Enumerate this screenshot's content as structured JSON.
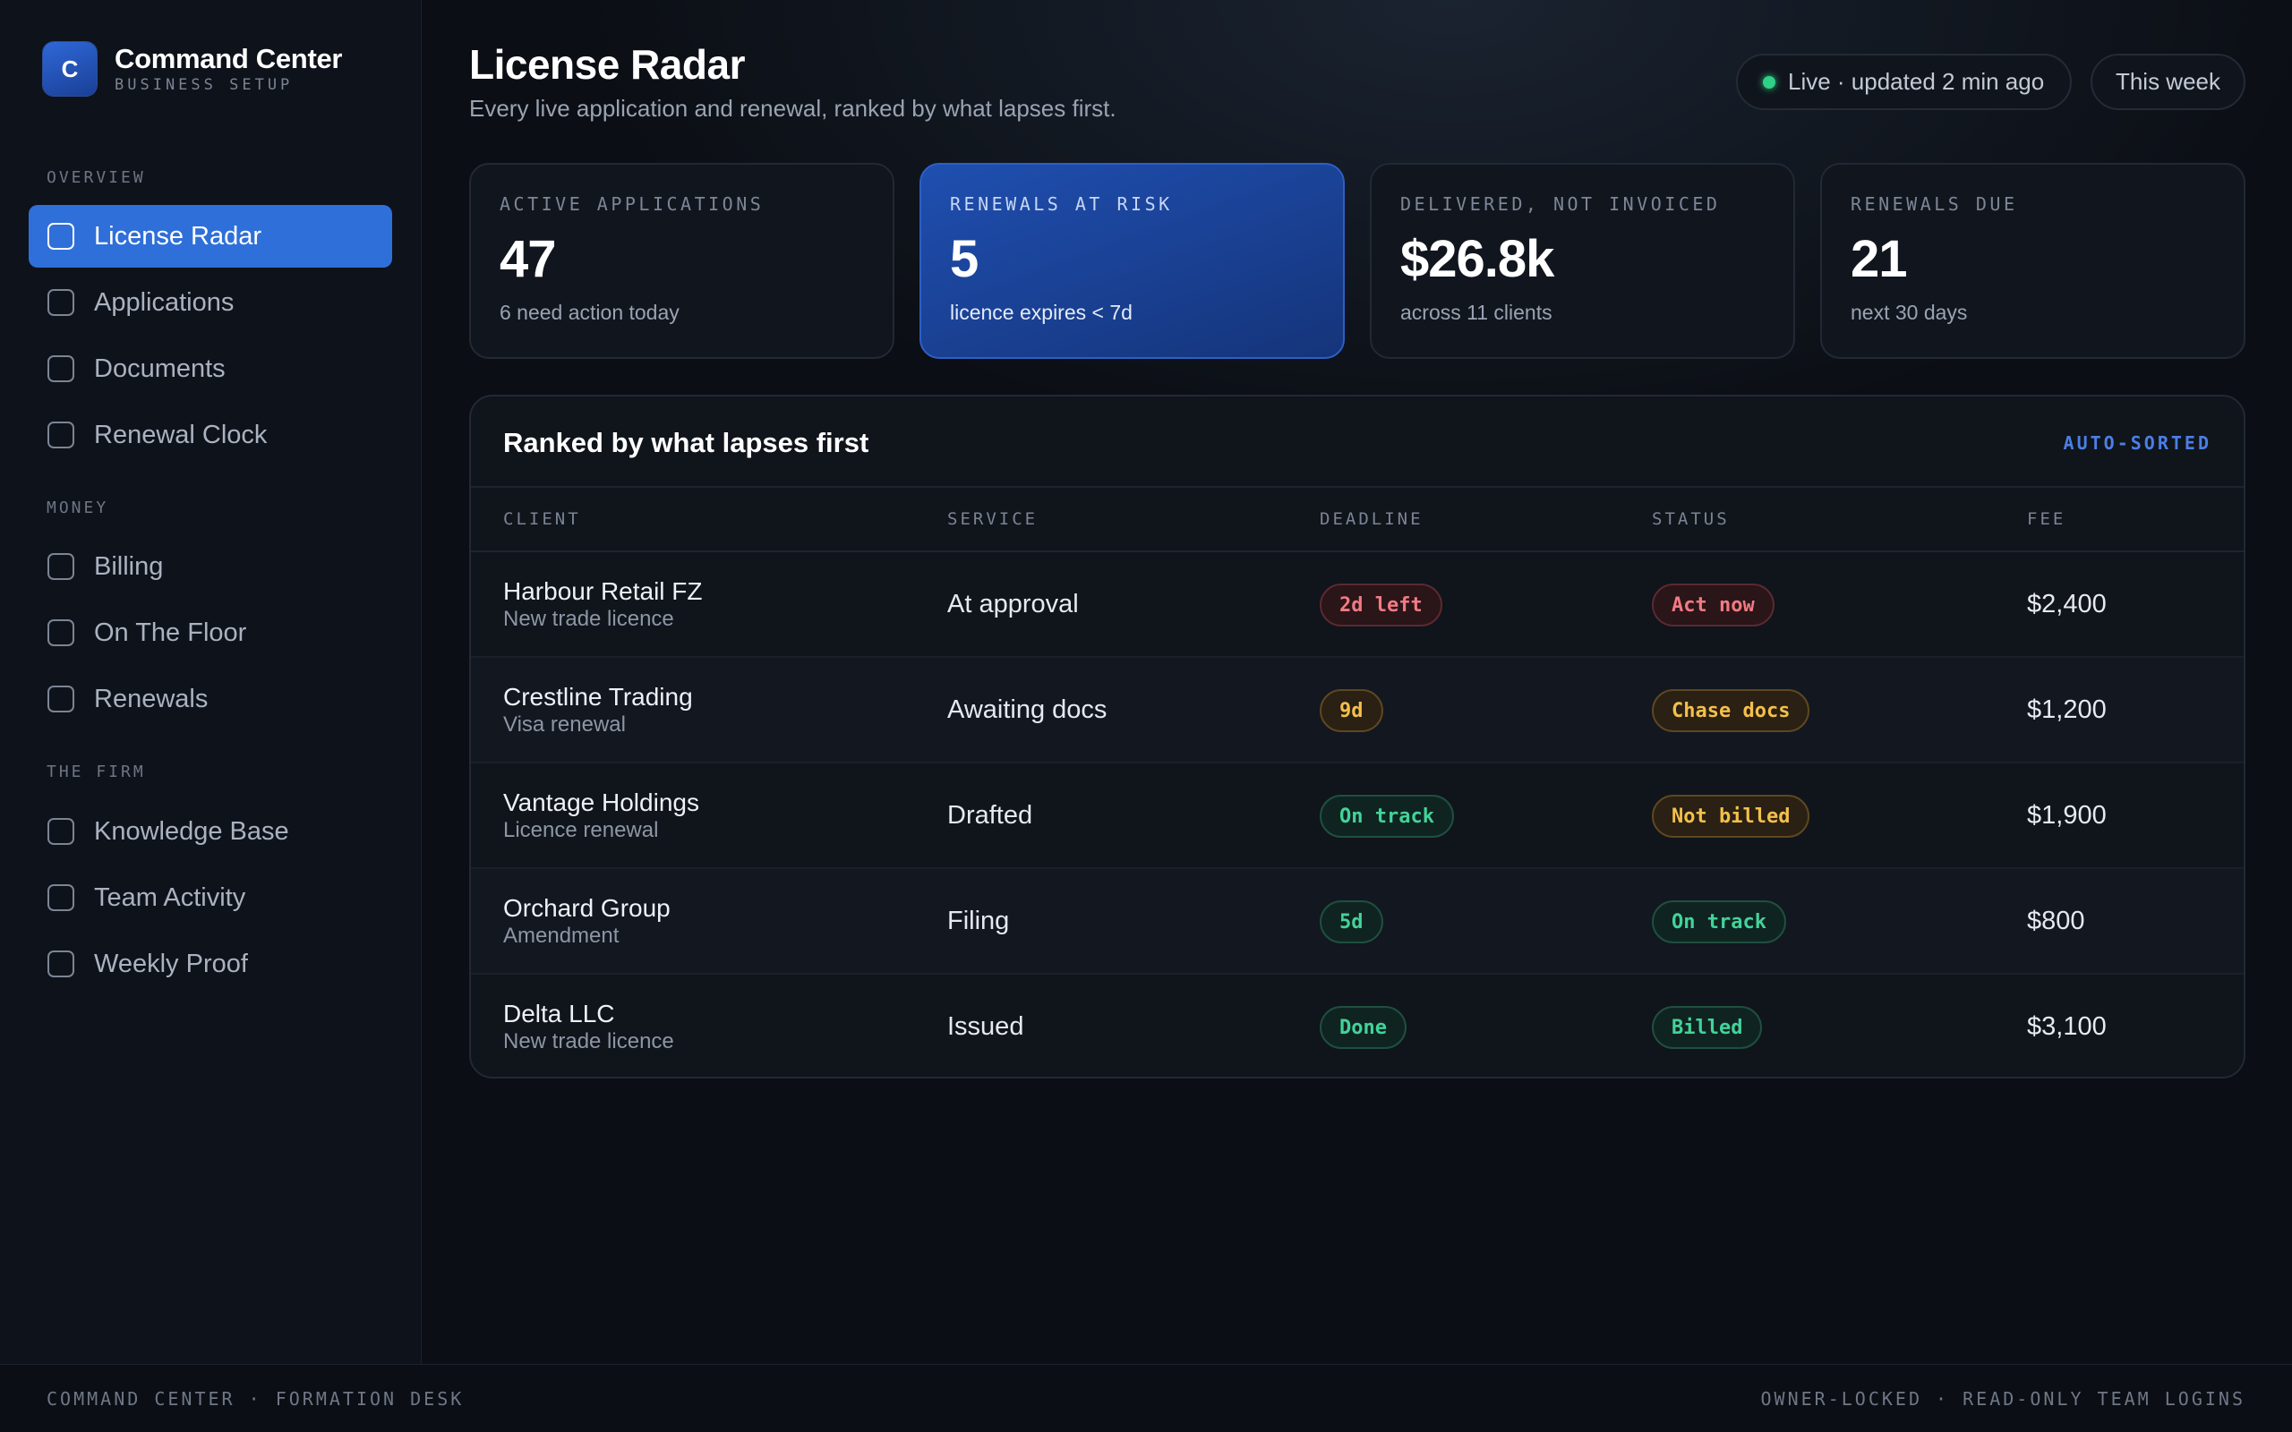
{
  "brand": {
    "logo_letter": "C",
    "title": "Command Center",
    "subtitle": "BUSINESS SETUP"
  },
  "sidebar": {
    "sections": [
      {
        "label": "OVERVIEW",
        "items": [
          "License Radar",
          "Applications",
          "Documents",
          "Renewal Clock"
        ]
      },
      {
        "label": "MONEY",
        "items": [
          "Billing",
          "On The Floor",
          "Renewals"
        ]
      },
      {
        "label": "THE FIRM",
        "items": [
          "Knowledge Base",
          "Team Activity",
          "Weekly Proof"
        ]
      }
    ],
    "active_item": "License Radar"
  },
  "header": {
    "title": "License Radar",
    "subtitle": "Every live application and renewal, ranked by what lapses first.",
    "live_status": "Live · updated 2 min ago",
    "period": "This week"
  },
  "stats": [
    {
      "label": "ACTIVE APPLICATIONS",
      "value": "47",
      "note": "6 need action today"
    },
    {
      "label": "RENEWALS AT RISK",
      "value": "5",
      "note": "licence expires < 7d"
    },
    {
      "label": "DELIVERED, NOT INVOICED",
      "value": "$26.8k",
      "note": "across 11 clients"
    },
    {
      "label": "RENEWALS DUE",
      "value": "21",
      "note": "next 30 days"
    }
  ],
  "table": {
    "title": "Ranked by what lapses first",
    "tag": "AUTO-SORTED",
    "columns": [
      "CLIENT",
      "SERVICE",
      "DEADLINE",
      "STATUS",
      "FEE"
    ],
    "rows": [
      {
        "client": "Harbour Retail FZ",
        "type": "New trade licence",
        "service": "At approval",
        "deadline": "2d left",
        "deadline_tone": "red",
        "status": "Act now",
        "status_tone": "red",
        "fee": "$2,400"
      },
      {
        "client": "Crestline Trading",
        "type": "Visa renewal",
        "service": "Awaiting docs",
        "deadline": "9d",
        "deadline_tone": "amber",
        "status": "Chase docs",
        "status_tone": "amber",
        "fee": "$1,200"
      },
      {
        "client": "Vantage Holdings",
        "type": "Licence renewal",
        "service": "Drafted",
        "deadline": "On track",
        "deadline_tone": "green",
        "status": "Not billed",
        "status_tone": "amber",
        "fee": "$1,900"
      },
      {
        "client": "Orchard Group",
        "type": "Amendment",
        "service": "Filing",
        "deadline": "5d",
        "deadline_tone": "green",
        "status": "On track",
        "status_tone": "green",
        "fee": "$800"
      },
      {
        "client": "Delta LLC",
        "type": "New trade licence",
        "service": "Issued",
        "deadline": "Done",
        "deadline_tone": "green",
        "status": "Billed",
        "status_tone": "green",
        "fee": "$3,100"
      }
    ]
  },
  "footer": {
    "left": "COMMAND CENTER · FORMATION DESK",
    "right": "OWNER-LOCKED · READ-ONLY TEAM LOGINS"
  },
  "colors": {
    "accent": "#2f6fd9",
    "live_dot": "#2fd186",
    "badge_red": "#f27a82",
    "badge_amber": "#f4c04b",
    "badge_green": "#43d39b"
  }
}
